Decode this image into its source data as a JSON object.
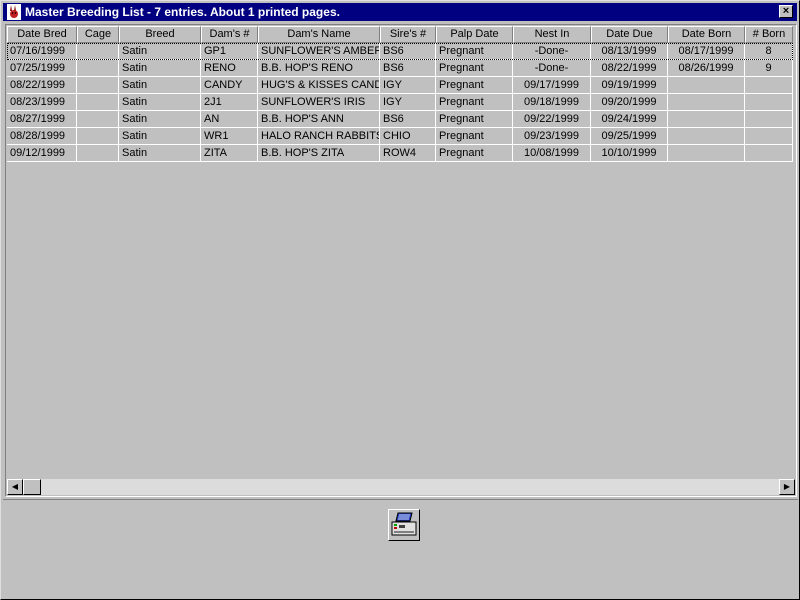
{
  "window": {
    "title": "Master Breeding List - 7 entries.  About 1 printed pages.",
    "close_label": "×"
  },
  "table": {
    "columns": [
      {
        "key": "date_bred",
        "label": "Date Bred"
      },
      {
        "key": "cage",
        "label": "Cage"
      },
      {
        "key": "breed",
        "label": "Breed"
      },
      {
        "key": "dams_num",
        "label": "Dam's #"
      },
      {
        "key": "dams_name",
        "label": "Dam's Name"
      },
      {
        "key": "sires_num",
        "label": "Sire's #"
      },
      {
        "key": "palp_date",
        "label": "Palp Date"
      },
      {
        "key": "nest_in",
        "label": "Nest In"
      },
      {
        "key": "date_due",
        "label": "Date Due"
      },
      {
        "key": "date_born",
        "label": "Date Born"
      },
      {
        "key": "num_born",
        "label": "# Born"
      }
    ],
    "rows": [
      [
        "07/16/1999",
        "",
        "Satin",
        "GP1",
        "SUNFLOWER'S AMBER",
        "BS6",
        "Pregnant",
        "-Done-",
        "08/13/1999",
        "08/17/1999",
        "8"
      ],
      [
        "07/25/1999",
        "",
        "Satin",
        "RENO",
        "B.B. HOP'S RENO",
        "BS6",
        "Pregnant",
        "-Done-",
        "08/22/1999",
        "08/26/1999",
        "9"
      ],
      [
        "08/22/1999",
        "",
        "Satin",
        "CANDY",
        "HUG'S & KISSES CANDY",
        "IGY",
        "Pregnant",
        "09/17/1999",
        "09/19/1999",
        "",
        ""
      ],
      [
        "08/23/1999",
        "",
        "Satin",
        "2J1",
        "SUNFLOWER'S IRIS",
        "IGY",
        "Pregnant",
        "09/18/1999",
        "09/20/1999",
        "",
        ""
      ],
      [
        "08/27/1999",
        "",
        "Satin",
        "AN",
        "B.B. HOP'S ANN",
        "BS6",
        "Pregnant",
        "09/22/1999",
        "09/24/1999",
        "",
        ""
      ],
      [
        "08/28/1999",
        "",
        "Satin",
        "WR1",
        "HALO RANCH RABBITS",
        "CHIO",
        "Pregnant",
        "09/23/1999",
        "09/25/1999",
        "",
        ""
      ],
      [
        "09/12/1999",
        "",
        "Satin",
        "ZITA",
        "B.B. HOP'S ZITA",
        "ROW4",
        "Pregnant",
        "10/08/1999",
        "10/10/1999",
        "",
        ""
      ]
    ]
  },
  "scrollbar": {
    "left_arrow": "◀",
    "right_arrow": "▶"
  },
  "icons": {
    "app": "rabbit-icon",
    "print": "printer-icon"
  }
}
